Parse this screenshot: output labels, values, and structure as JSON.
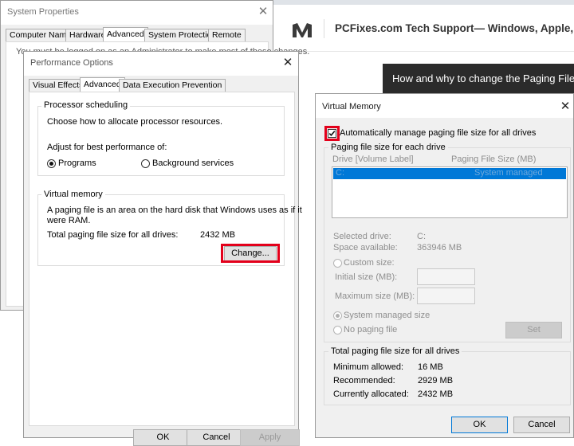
{
  "background": {
    "site": "PCFixes.com Tech Support— Windows, Apple, G",
    "video_title": "How and why to change the Paging File"
  },
  "system_properties": {
    "title": "System Properties",
    "tabs": [
      "Computer Name",
      "Hardware",
      "Advanced",
      "System Protection",
      "Remote"
    ],
    "active_tab": "Advanced",
    "notice": "You must be logged on as an Administrator to make most of these changes."
  },
  "performance_options": {
    "title": "Performance Options",
    "tabs": [
      "Visual Effects",
      "Advanced",
      "Data Execution Prevention"
    ],
    "active_tab": "Advanced",
    "processor": {
      "group_label": "Processor scheduling",
      "description": "Choose how to allocate processor resources.",
      "adjust_label": "Adjust for best performance of:",
      "option_programs": "Programs",
      "option_background": "Background services",
      "selected": "Programs"
    },
    "virtual_memory": {
      "group_label": "Virtual memory",
      "description_line1": "A paging file is an area on the hard disk that Windows uses as if it",
      "description_line2": "were RAM.",
      "total_label": "Total paging file size for all drives:",
      "total_value": "2432 MB",
      "change_button": "Change..."
    },
    "buttons": {
      "ok": "OK",
      "cancel": "Cancel",
      "apply": "Apply"
    }
  },
  "virtual_memory_dialog": {
    "title": "Virtual Memory",
    "auto_manage_label": "Automatically manage paging file size for all drives",
    "auto_manage_checked": true,
    "paging_group_label": "Paging file size for each drive",
    "columns": {
      "drive": "Drive  [Volume Label]",
      "size": "Paging File Size (MB)"
    },
    "drive_rows": [
      {
        "drive": "C:",
        "size": "System managed"
      }
    ],
    "selected_drive_label": "Selected drive:",
    "selected_drive_value": "C:",
    "space_label": "Space available:",
    "space_value": "363946 MB",
    "custom_size_label": "Custom size:",
    "initial_size_label": "Initial size (MB):",
    "maximum_size_label": "Maximum size (MB):",
    "system_managed_label": "System managed size",
    "no_paging_label": "No paging file",
    "set_button": "Set",
    "total_group_label": "Total paging file size for all drives",
    "minimum_label": "Minimum allowed:",
    "minimum_value": "16 MB",
    "recommended_label": "Recommended:",
    "recommended_value": "2929 MB",
    "allocated_label": "Currently allocated:",
    "allocated_value": "2432 MB",
    "ok_button": "OK",
    "cancel_button": "Cancel"
  },
  "colors": {
    "highlight_red": "#e3001b",
    "selection_blue": "#0078d7",
    "focus_blue": "#0078d7"
  }
}
